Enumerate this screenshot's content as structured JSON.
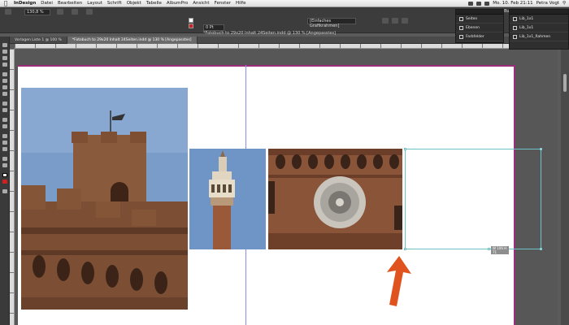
{
  "menubar": {
    "app": "InDesign",
    "items": [
      "Datei",
      "Bearbeiten",
      "Layout",
      "Schrift",
      "Objekt",
      "Tabelle",
      "AlbumPro",
      "Ansicht",
      "Fenster",
      "Hilfe"
    ],
    "clock": "Mo. 10. Feb 21:11",
    "user": "Petra Vogt"
  },
  "controlbar": {
    "zoom": "130,8 %",
    "style_field": "[Einfaches Grafikrahmen]",
    "stroke_weight": "0 Pt",
    "workspace": "Buch"
  },
  "document": {
    "title": "*Fotobuch to 29x20 Inhalt 24Seiten.indd @ 130 % [Angepasstes]",
    "tabs": [
      {
        "label": "Vorlagen Liste 1 @ 100 %",
        "active": false
      },
      {
        "label": "*Fotobuch to 29x20 Inhalt 24Seiten.indd @ 130 % [Angepasstes]",
        "active": true
      }
    ]
  },
  "panels": {
    "left": {
      "title": "",
      "items": [
        "Seiten",
        "Ebenen",
        "Farbfelder"
      ]
    },
    "right": {
      "title": "",
      "items": [
        "Lib_1x1",
        "Lib_1x1",
        "Lib_1x1_Rahmen"
      ]
    }
  },
  "frame_size_label": "W 106 H 71",
  "colors": {
    "page_edge": "#9b2d7a",
    "selection": "#6cc2c6",
    "guide": "#8c8cf0",
    "arrow": "#e0531f",
    "sky": "#7a9cc8",
    "brick": "#8a5a3c"
  },
  "icons": {
    "apple": "apple-icon",
    "arrow": "arrow-up-icon"
  }
}
